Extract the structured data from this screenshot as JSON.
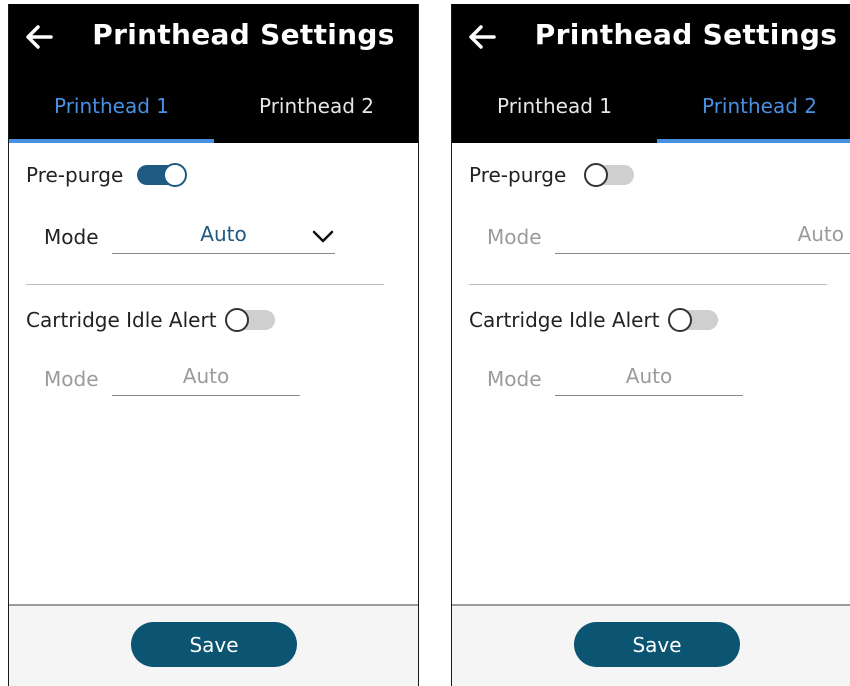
{
  "screens": [
    {
      "title": "Printhead Settings",
      "tabs": [
        "Printhead 1",
        "Printhead 2"
      ],
      "active_tab": 0,
      "pre_purge": {
        "label": "Pre-purge",
        "enabled": true,
        "mode_label": "Mode",
        "mode_value": "Auto"
      },
      "idle_alert": {
        "label": "Cartridge Idle Alert",
        "enabled": false,
        "mode_label": "Mode",
        "mode_value": "Auto"
      },
      "save_label": "Save"
    },
    {
      "title": "Printhead Settings",
      "tabs": [
        "Printhead 1",
        "Printhead 2"
      ],
      "active_tab": 1,
      "pre_purge": {
        "label": "Pre-purge",
        "enabled": false,
        "mode_label": "Mode",
        "mode_value": "Auto"
      },
      "idle_alert": {
        "label": "Cartridge Idle Alert",
        "enabled": false,
        "mode_label": "Mode",
        "mode_value": "Auto"
      },
      "save_label": "Save"
    }
  ],
  "colors": {
    "header_bg": "#000000",
    "accent": "#4a90e2",
    "toggle_on": "#1f5a80",
    "toggle_off": "#cfcfcf",
    "save_button": "#0b5472",
    "disabled_text": "#9b9b9b"
  },
  "icons": {
    "back": "arrow-left-icon",
    "dropdown": "chevron-down-icon"
  }
}
